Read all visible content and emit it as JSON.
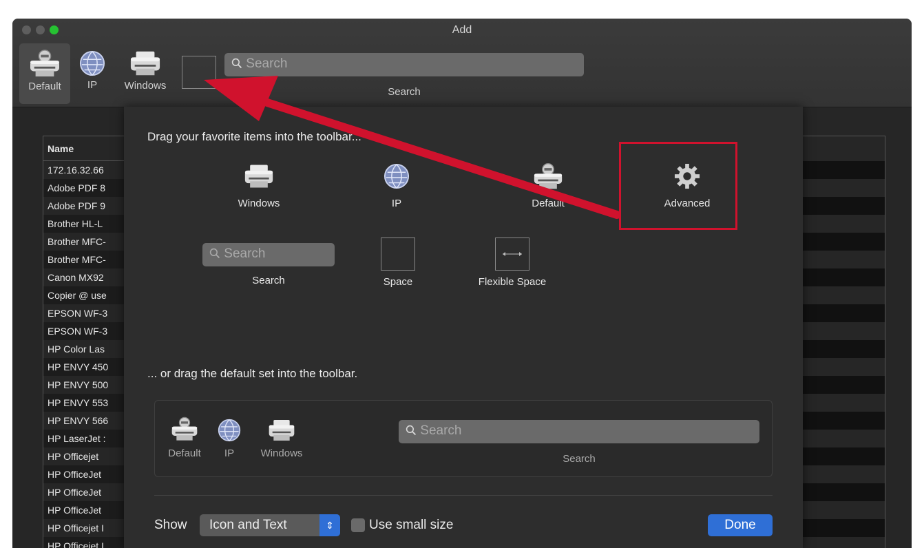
{
  "window": {
    "title": "Add"
  },
  "toolbar": {
    "items": [
      {
        "label": "Default",
        "icon": "printer-network-icon"
      },
      {
        "label": "IP",
        "icon": "globe-icon"
      },
      {
        "label": "Windows",
        "icon": "printer-icon"
      }
    ],
    "search_placeholder": "Search",
    "search_label": "Search"
  },
  "printer_list": {
    "header": "Name",
    "rows": [
      "172.16.32.66",
      "Adobe PDF 8",
      "Adobe PDF 9",
      "Brother HL-L",
      "Brother MFC-",
      "Brother MFC-",
      "Canon MX92",
      "Copier @ use",
      "EPSON WF-3",
      "EPSON WF-3",
      "HP Color Las",
      "HP ENVY 450",
      "HP ENVY 500",
      "HP ENVY 553",
      "HP ENVY 566",
      "HP LaserJet :",
      "HP Officejet",
      "HP OfficeJet",
      "HP OfficeJet",
      "HP OfficeJet",
      "HP Officejet I",
      "HP Officejet I"
    ]
  },
  "customize": {
    "drag_favorites": "Drag your favorite items into the toolbar...",
    "palette": [
      {
        "label": "Windows",
        "icon": "printer-icon"
      },
      {
        "label": "IP",
        "icon": "globe-icon"
      },
      {
        "label": "Default",
        "icon": "printer-network-icon"
      },
      {
        "label": "Advanced",
        "icon": "gear-icon"
      }
    ],
    "palette_row2": {
      "search_placeholder": "Search",
      "search_label": "Search",
      "space_label": "Space",
      "flex_label": "Flexible Space"
    },
    "drag_default": "... or drag the default set into the toolbar.",
    "default_set": {
      "items": [
        "Default",
        "IP",
        "Windows"
      ],
      "search_placeholder": "Search",
      "search_label": "Search"
    },
    "show_label": "Show",
    "show_value": "Icon and Text",
    "small_size_label": "Use small size",
    "done_label": "Done"
  },
  "colors": {
    "annotation": "#d0122d",
    "accent": "#2f6fd6"
  }
}
